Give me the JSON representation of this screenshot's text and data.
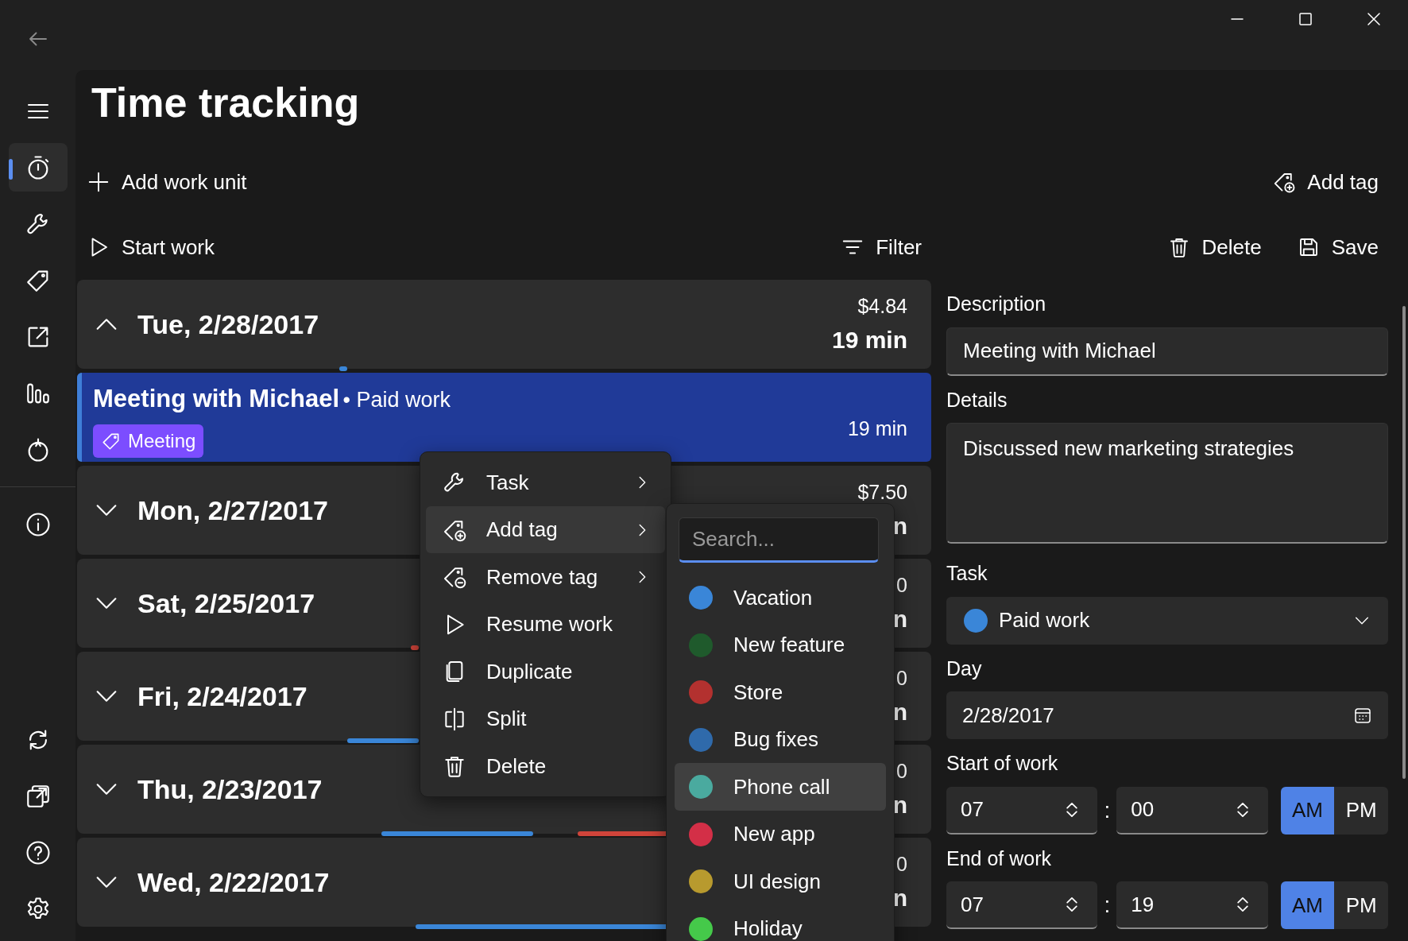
{
  "nav": {
    "items": [
      {
        "kind": "timer",
        "selected": true
      },
      {
        "kind": "wrench",
        "selected": false
      },
      {
        "kind": "tag",
        "selected": false
      },
      {
        "kind": "share",
        "selected": false
      },
      {
        "kind": "chart",
        "selected": false
      },
      {
        "kind": "tomato",
        "selected": false
      }
    ],
    "footer": [
      {
        "kind": "info"
      },
      {
        "kind": "sync"
      },
      {
        "kind": "export"
      },
      {
        "kind": "help"
      },
      {
        "kind": "settings"
      }
    ]
  },
  "page": {
    "title": "Time tracking"
  },
  "toolbar": {
    "add_work_unit": "Add work unit",
    "start_work": "Start work",
    "filter": "Filter",
    "add_tag": "Add tag",
    "delete": "Delete",
    "save": "Save"
  },
  "days": [
    {
      "date": "Tue, 2/28/2017",
      "expanded": true,
      "amount": "$4.84",
      "duration": "19 min",
      "entries": [
        {
          "title": "Meeting with Michael",
          "task": "• Paid work",
          "tag": "Meeting",
          "duration": "19 min",
          "selected": true
        }
      ]
    },
    {
      "date": "Mon, 2/27/2017",
      "expanded": false,
      "amount": "$7.50",
      "duration": "n"
    },
    {
      "date": "Sat, 2/25/2017",
      "expanded": false,
      "amount": "0",
      "duration": "n"
    },
    {
      "date": "Fri, 2/24/2017",
      "expanded": false,
      "amount": "0",
      "duration": "n"
    },
    {
      "date": "Thu, 2/23/2017",
      "expanded": false,
      "amount": "0",
      "duration": "n"
    },
    {
      "date": "Wed, 2/22/2017",
      "expanded": false,
      "amount": "0",
      "duration": "n"
    }
  ],
  "context_menu": {
    "items": [
      {
        "kind": "wrench",
        "label": "Task",
        "submenu": true,
        "selected": false
      },
      {
        "kind": "tag-add",
        "label": "Add tag",
        "submenu": true,
        "selected": true
      },
      {
        "kind": "tag-remove",
        "label": "Remove tag",
        "submenu": true,
        "selected": false
      },
      {
        "kind": "play",
        "label": "Resume work",
        "submenu": false,
        "selected": false
      },
      {
        "kind": "duplicate",
        "label": "Duplicate",
        "submenu": false,
        "selected": false
      },
      {
        "kind": "split",
        "label": "Split",
        "submenu": false,
        "selected": false
      },
      {
        "kind": "trash",
        "label": "Delete",
        "submenu": false,
        "selected": false
      }
    ]
  },
  "tag_submenu": {
    "search": {
      "placeholder": "Search..."
    },
    "tags": [
      {
        "label": "Vacation",
        "color": "#3a86d8",
        "selected": false
      },
      {
        "label": "New feature",
        "color": "#1f5a2c",
        "selected": false
      },
      {
        "label": "Store",
        "color": "#b3312f",
        "selected": false
      },
      {
        "label": "Bug fixes",
        "color": "#2f6aab",
        "selected": false
      },
      {
        "label": "Phone call",
        "color": "#4aaa9f",
        "selected": true
      },
      {
        "label": "New app",
        "color": "#d32f47",
        "selected": false
      },
      {
        "label": "UI design",
        "color": "#b89a2e",
        "selected": false
      },
      {
        "label": "Holiday",
        "color": "#45c94a",
        "selected": false
      }
    ]
  },
  "details": {
    "description": {
      "label": "Description",
      "value": "Meeting with Michael"
    },
    "details": {
      "label": "Details",
      "value": "Discussed new marketing strategies"
    },
    "task": {
      "label": "Task",
      "value": "Paid work",
      "color": "#3a86d8"
    },
    "day": {
      "label": "Day",
      "value": "2/28/2017"
    },
    "times": [
      {
        "label": "Start of work",
        "hour": "07",
        "separator": ":",
        "minute": "00",
        "periods": [
          {
            "label": "AM",
            "selected": true
          },
          {
            "label": "PM",
            "selected": false
          }
        ]
      },
      {
        "label": "End of work",
        "hour": "07",
        "separator": ":",
        "minute": "19",
        "periods": [
          {
            "label": "AM",
            "selected": true
          },
          {
            "label": "PM",
            "selected": false
          }
        ]
      }
    ]
  }
}
